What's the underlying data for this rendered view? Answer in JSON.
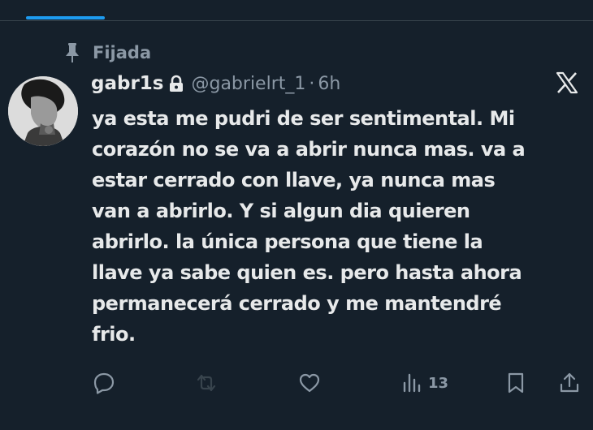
{
  "pinned": {
    "label": "Fijada",
    "icon": "pin-icon"
  },
  "author": {
    "display_name": "gabr1s",
    "handle": "@gabrielrt_1",
    "separator": "·",
    "time": "6h",
    "protected_icon": "lock-icon"
  },
  "platform_icon": "x-logo-icon",
  "tweet": {
    "lines": [
      "ya esta me pudri de ser sentimental. Mi",
      "corazón no se va a abrir nunca mas. va a",
      "estar cerrado con llave, ya nunca mas",
      "van a abrirlo. Y si algun dia quieren",
      "abrirlo. la única persona que tiene la",
      "llave ya sabe quien es. pero hasta ahora",
      "permanecerá cerrado y me mantendré",
      "frio."
    ]
  },
  "actions": {
    "reply_icon": "reply-icon",
    "retweet_icon": "retweet-icon",
    "like_icon": "like-icon",
    "views_icon": "views-icon",
    "views_count": "13",
    "bookmark_icon": "bookmark-icon",
    "share_icon": "share-icon"
  },
  "colors": {
    "background": "#15202b",
    "text": "#e7e9ea",
    "secondary": "#8b98a5",
    "accent": "#1d9bf0",
    "retweet_disabled": "#38444d"
  }
}
